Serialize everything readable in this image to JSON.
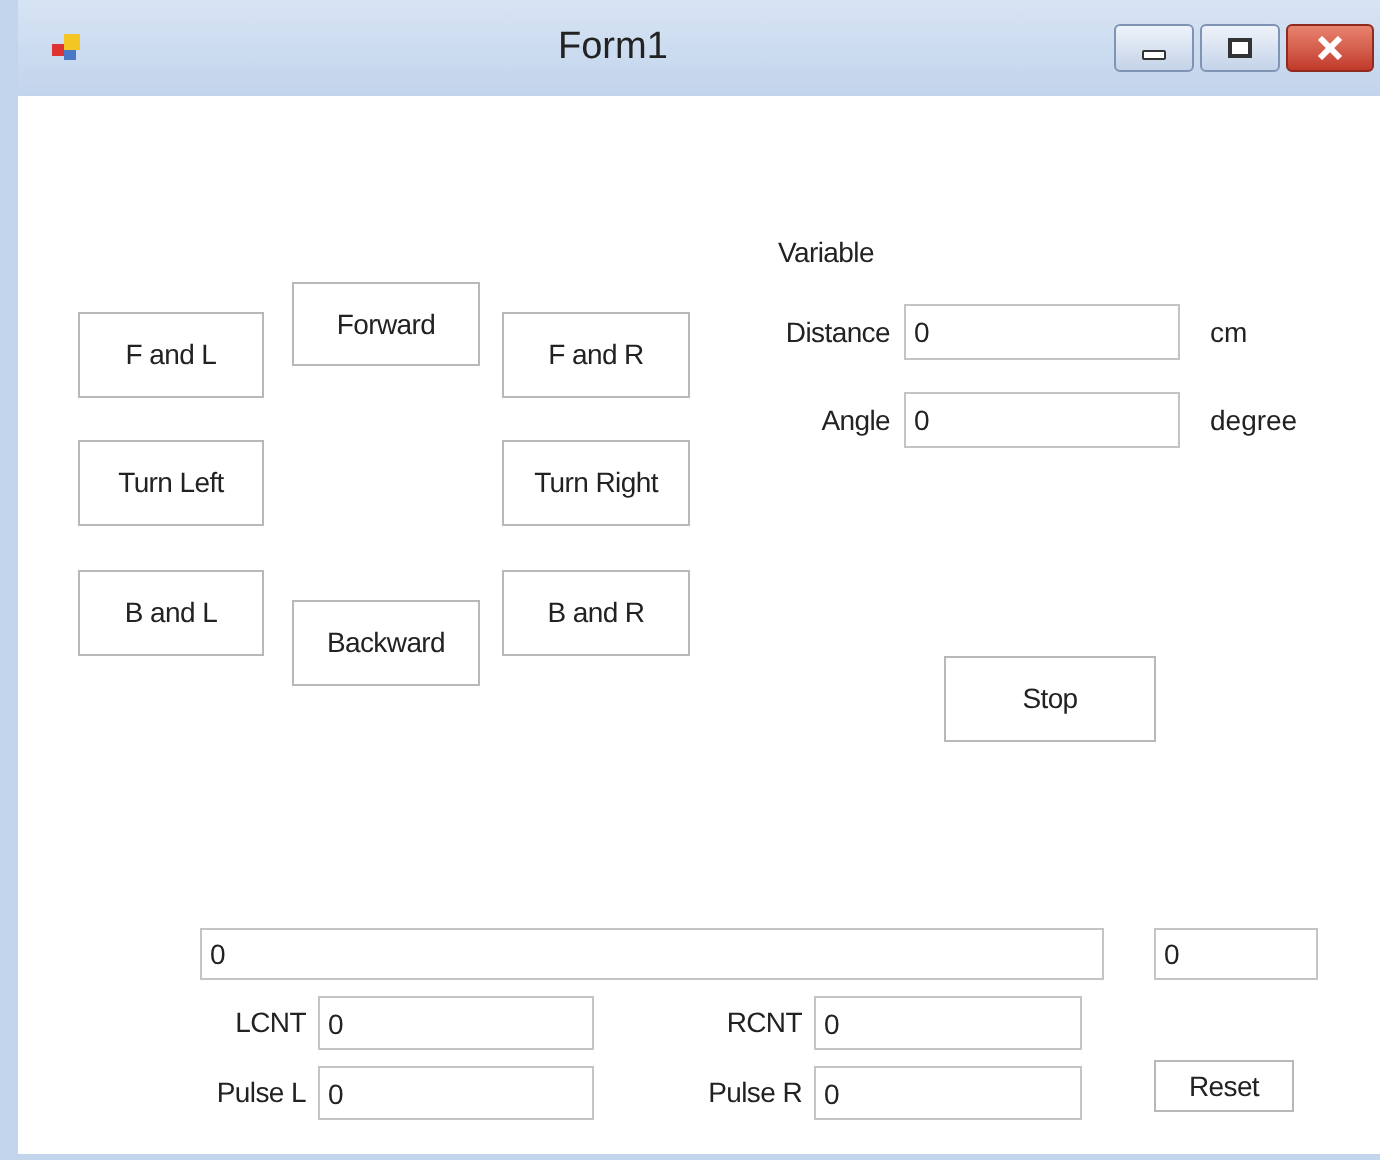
{
  "window": {
    "title": "Form1"
  },
  "direction_buttons": {
    "forward_left": "F and L",
    "forward": "Forward",
    "forward_right": "F and R",
    "turn_left": "Turn Left",
    "turn_right": "Turn Right",
    "back_left": "B and L",
    "backward": "Backward",
    "back_right": "B and R"
  },
  "variable_panel": {
    "title": "Variable",
    "rows": [
      {
        "label": "Distance",
        "value": "0",
        "unit": "cm"
      },
      {
        "label": "Angle",
        "value": "0",
        "unit": "degree"
      }
    ]
  },
  "stop_button": "Stop",
  "output_field": {
    "value": "0"
  },
  "side_field": {
    "value": "0"
  },
  "counters": [
    {
      "label": "LCNT",
      "value": "0"
    },
    {
      "label": "RCNT",
      "value": "0"
    },
    {
      "label": "Pulse L",
      "value": "0"
    },
    {
      "label": "Pulse R",
      "value": "0"
    }
  ],
  "reset_button": "Reset"
}
